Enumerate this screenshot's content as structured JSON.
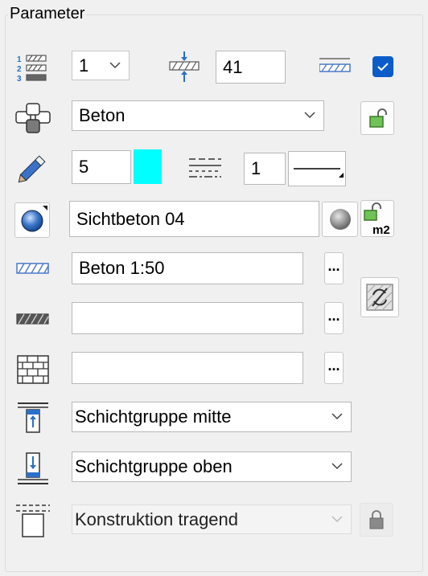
{
  "group": {
    "title": "Parameter"
  },
  "row1": {
    "layer_number": "1",
    "thickness": "41",
    "checkbox_checked": true
  },
  "row2": {
    "material": "Beton"
  },
  "row3": {
    "pen": "5",
    "pen_color": "#00ffff",
    "line_type": "1"
  },
  "row4": {
    "surface": "Sichtbeton 04",
    "area_unit": "m2"
  },
  "row5": {
    "hatch": "Beton 1:50",
    "more": "..."
  },
  "row6": {
    "pattern": "",
    "more": "..."
  },
  "row7": {
    "filling": "",
    "more": "..."
  },
  "row8": {
    "layer_group_bottom": "Schichtgruppe mitte"
  },
  "row9": {
    "layer_group_top": "Schichtgruppe oben"
  },
  "row10": {
    "construction": "Konstruktion tragend"
  },
  "colors": {
    "accent": "#2a6fc9",
    "checkbox": "#0b5cc9",
    "hatch_blue": "#4a78c8"
  }
}
